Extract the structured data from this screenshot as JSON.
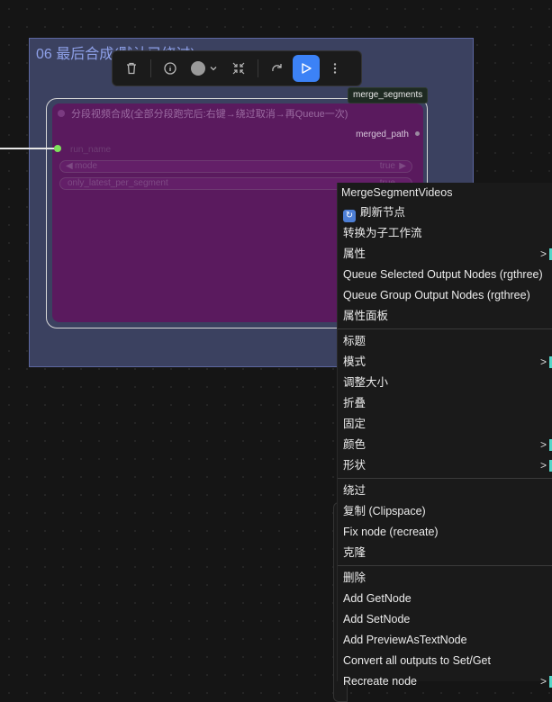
{
  "group": {
    "title": "06 最后合成(默认已绕过)"
  },
  "toolbar": {
    "buttons": [
      "delete-icon",
      "info-icon",
      "color-icon",
      "collapse-icon",
      "bypass-icon",
      "run-icon",
      "more-icon"
    ],
    "run_color": "#3c82f6"
  },
  "node": {
    "badge": "merge_segments",
    "title": "分段视频合成(全部分段跑完后:右键→绕过取消→再Queue一次)",
    "output": "merged_path",
    "input": "run_name",
    "widgets": [
      {
        "name": "mode",
        "value": "true"
      },
      {
        "name": "only_latest_per_segment",
        "value": "true"
      }
    ],
    "color": "#5a1a5e"
  },
  "menu": {
    "title": "MergeSegmentVideos",
    "sections": [
      [
        {
          "label": "刷新节点",
          "icon": "refresh-icon"
        },
        {
          "label": "转换为子工作流"
        },
        {
          "label": "属性",
          "submenu": true
        },
        {
          "label": "Queue Selected Output Nodes (rgthree)"
        },
        {
          "label": "Queue Group Output Nodes (rgthree)"
        },
        {
          "label": "属性面板"
        }
      ],
      [
        {
          "label": "标题"
        },
        {
          "label": "模式",
          "submenu": true
        },
        {
          "label": "调整大小"
        },
        {
          "label": "折叠"
        },
        {
          "label": "固定"
        },
        {
          "label": "颜色",
          "submenu": true
        },
        {
          "label": "形状",
          "submenu": true
        }
      ],
      [
        {
          "label": "绕过"
        },
        {
          "label": "复制 (Clipspace)"
        },
        {
          "label": "Fix node (recreate)"
        },
        {
          "label": "克隆"
        }
      ],
      [
        {
          "label": "删除"
        },
        {
          "label": "Add GetNode"
        },
        {
          "label": "Add SetNode"
        },
        {
          "label": "Add PreviewAsTextNode"
        },
        {
          "label": "Convert all outputs to Set/Get"
        },
        {
          "label": "Recreate node",
          "submenu": true
        }
      ]
    ]
  }
}
